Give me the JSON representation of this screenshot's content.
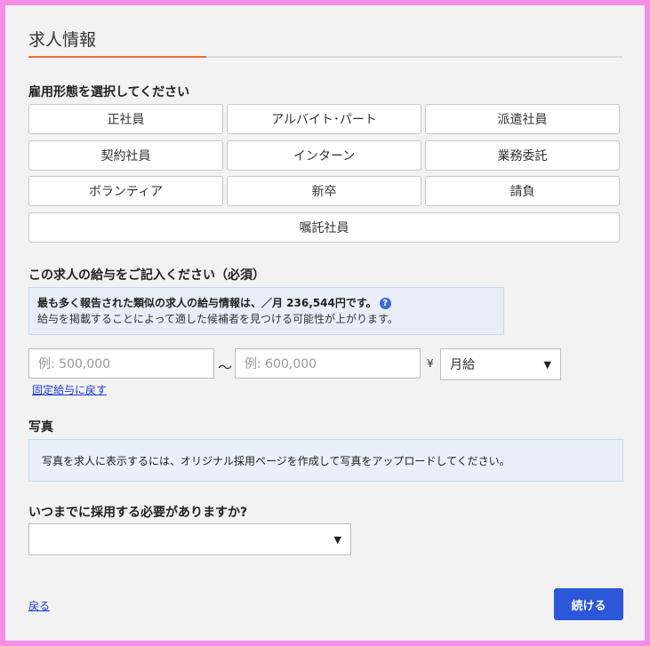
{
  "header": {
    "title": "求人情報"
  },
  "employment": {
    "label": "雇用形態を選択してください",
    "types": [
      "正社員",
      "アルバイト･パート",
      "派遣社員",
      "契約社員",
      "インターン",
      "業務委託",
      "ボランティア",
      "新卒",
      "請負",
      "嘱託社員"
    ]
  },
  "salary": {
    "label": "この求人の給与をご記入ください（必須）",
    "info_line1": "最も多く報告された類似の求人の給与情報は、／月 236,544円です。",
    "info_help_icon": "help-icon",
    "info_line2": "給与を掲載することによって適した候補者を見つける可能性が上がります。",
    "min_placeholder": "例: 500,000",
    "tilde": "～",
    "max_placeholder": "例: 600,000",
    "currency": "¥",
    "period_selected": "月給",
    "fixed_link": "固定給与に戻す"
  },
  "photo": {
    "label": "写真",
    "message": "写真を求人に表示するには、オリジナル採用ページを作成して写真をアップロードしてください。"
  },
  "deadline": {
    "label": "いつまでに採用する必要がありますか?",
    "selected": ""
  },
  "footer": {
    "back_label": "戻る",
    "continue_label": "続ける"
  }
}
